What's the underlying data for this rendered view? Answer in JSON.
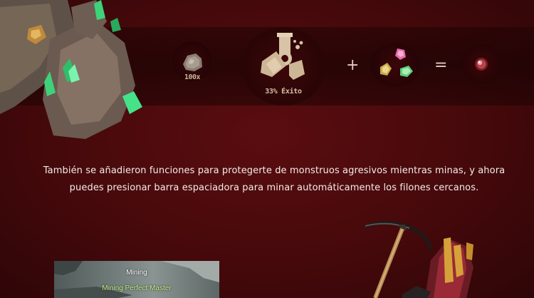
{
  "recipe": {
    "ore_quantity": "100x",
    "success_rate": "33% Éxito",
    "plus_sign": "+",
    "equals_sign": "="
  },
  "description": {
    "line1": "También se añadieron funciones para protegerte de monstruos agresivos mientras minas, y ahora",
    "line2": "puedes presionar barra espaciadora para minar automáticamente los filones cercanos."
  },
  "game_screenshot": {
    "skill_name": "Mining",
    "skill_level": "Mining Perfect Master"
  },
  "colors": {
    "background": "#46090b",
    "text": "#f3ece8",
    "accent_gold": "#c9a36a",
    "skill_green": "#c6f28a"
  }
}
